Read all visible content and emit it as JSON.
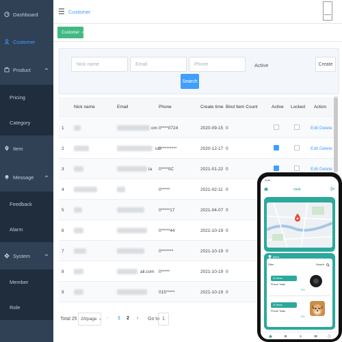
{
  "sidebar": {
    "items": [
      {
        "label": "Dashboard",
        "icon": "dashboard-icon"
      },
      {
        "label": "Customer",
        "icon": "user-icon",
        "active": true
      },
      {
        "label": "Product",
        "icon": "product-icon",
        "expandable": true
      },
      {
        "label": "Item",
        "icon": "location-icon"
      },
      {
        "label": "Message",
        "icon": "message-icon",
        "expandable": true
      },
      {
        "label": "System",
        "icon": "gear-icon",
        "expandable": true
      }
    ],
    "product_children": [
      "Pricing",
      "Category"
    ],
    "message_children": [
      "Feedback",
      "Alarm"
    ],
    "system_children": [
      "Member",
      "Role"
    ]
  },
  "header": {
    "breadcrumb": "Customer"
  },
  "tags": {
    "active_tag": "Customer"
  },
  "filters": {
    "nickname_placeholder": "Nick name",
    "email_placeholder": "Email",
    "phone_placeholder": "Phone",
    "active_label": "Active",
    "create_label": "Create",
    "search_label": "Search"
  },
  "table": {
    "columns": [
      "Nick name",
      "Email",
      "Phone",
      "Create time",
      "Bind Item Count",
      "Active",
      "Locked",
      "Action"
    ],
    "rows": [
      {
        "index": "1",
        "nick_tail": "",
        "email_tail": "om",
        "phone": "0****0724",
        "create_time": "2020-09-15",
        "bind_count": "0",
        "active": false,
        "locked": false
      },
      {
        "index": "2",
        "nick_tail": "",
        "email_tail": "iob",
        "phone": "0*********",
        "create_time": "2020-12-17",
        "bind_count": "0",
        "active": true,
        "locked": false
      },
      {
        "index": "3",
        "nick_tail": "",
        "email_tail": "ia",
        "phone": "0****0C",
        "create_time": "2021-01-22",
        "bind_count": "0",
        "active": true,
        "locked": false
      },
      {
        "index": "4",
        "nick_tail": "",
        "email_tail": "",
        "phone": "0*****",
        "create_time": "2021-02-11",
        "bind_count": "0",
        "active": false,
        "locked": false
      },
      {
        "index": "5",
        "nick_tail": "",
        "email_tail": "",
        "phone": "0*****17",
        "create_time": "2021-04-07",
        "bind_count": "0",
        "active": false,
        "locked": false
      },
      {
        "index": "6",
        "nick_tail": "",
        "email_tail": "",
        "phone": "0*****44",
        "create_time": "2021-10-19",
        "bind_count": "0",
        "active": false,
        "locked": false
      },
      {
        "index": "7",
        "nick_tail": "",
        "email_tail": "",
        "phone": "0*******",
        "create_time": "2021-10-19",
        "bind_count": "0",
        "active": false,
        "locked": false
      },
      {
        "index": "8",
        "nick_tail": "",
        "email_tail": "ail.com",
        "phone": "0*****",
        "create_time": "2021-10-19",
        "bind_count": "0",
        "active": false,
        "locked": false
      },
      {
        "index": "9",
        "nick_tail": "",
        "email_tail": "",
        "phone": "015*****",
        "create_time": "2021-10-19",
        "bind_count": "0",
        "active": false,
        "locked": false
      }
    ],
    "edit_label": "Edit",
    "delete_label": "Delete"
  },
  "pagination": {
    "total": "Total 25",
    "page_size": "20/page",
    "pages": [
      "1",
      "2"
    ],
    "current_page": "1",
    "goto_label": "Go to",
    "goto_value": "1"
  },
  "phone": {
    "status_time": "3:06",
    "app_title": "Vauli",
    "card_label": "Items",
    "filter_label": "Filter",
    "search_label": "Search",
    "item1_name": "01 Items",
    "item1_label": "Phone Trails",
    "item2_name": "02 Items",
    "item2_label": "Phone Trails",
    "battery": "0%"
  },
  "colors": {
    "sidebar_bg": "#304156",
    "submenu_bg": "#1f2d3d",
    "accent": "#409eff",
    "tag_green": "#42b983",
    "phone_teal": "#2ca89c"
  }
}
